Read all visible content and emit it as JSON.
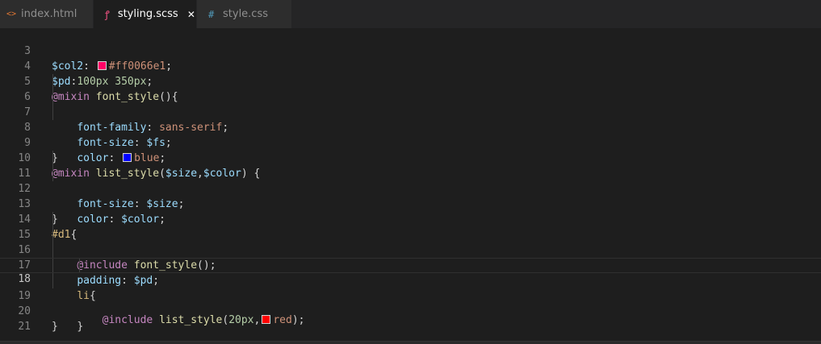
{
  "tabs": [
    {
      "label": "index.html",
      "icon": "html-icon",
      "glyph": "<>"
    },
    {
      "label": "styling.scss",
      "icon": "sass-icon",
      "glyph": "ꝭ",
      "active": true,
      "close": "✕"
    },
    {
      "label": "style.css",
      "icon": "css-icon",
      "glyph": "#"
    }
  ],
  "colors": {
    "col2_swatch": "#ff0066",
    "blue_swatch": "#0000ff",
    "red_swatch": "#ff0000"
  },
  "code": {
    "line_numbers": [
      "3",
      "4",
      "5",
      "6",
      "7",
      "8",
      "9",
      "10",
      "11",
      "12",
      "13",
      "14",
      "15",
      "16",
      "17",
      "18",
      "19",
      "20",
      "21"
    ],
    "l3": {
      "var": "$col2",
      "colon": ": ",
      "value": "#ff0066e1",
      "semi": ";"
    },
    "l4": {
      "var": "$pd",
      "colon": ":",
      "value": "100px 350px",
      "semi": ";"
    },
    "l5": {
      "kw": "@mixin",
      "name": "font_style",
      "rest": "(){"
    },
    "l6": {
      "prop": "font-family",
      "colon": ": ",
      "value": "sans-serif",
      "semi": ";"
    },
    "l7": {
      "prop": "font-size",
      "colon": ": ",
      "value": "$fs",
      "semi": ";"
    },
    "l8": {
      "prop": "color",
      "colon": ": ",
      "value": "blue",
      "semi": ";"
    },
    "l9": {
      "text": "}"
    },
    "l10": {
      "kw": "@mixin",
      "name": "list_style",
      "open": "(",
      "arg1": "$size",
      "comma": ",",
      "arg2": "$color",
      "close": ") {"
    },
    "l11": {
      "prop": "font-size",
      "colon": ": ",
      "value": "$size",
      "semi": ";"
    },
    "l12": {
      "prop": "color",
      "colon": ": ",
      "value": "$color",
      "semi": ";"
    },
    "l13": {
      "text": "}"
    },
    "l14": {
      "sel": "#d1",
      "rest": "{"
    },
    "l15": {
      "kw": "@include",
      "name": "font_style",
      "rest": "();"
    },
    "l16": {
      "prop": "padding",
      "colon": ": ",
      "value": "$pd",
      "semi": ";"
    },
    "l17": {
      "tag": "li",
      "rest": "{"
    },
    "l18": {
      "kw": "@include",
      "name": "list_style",
      "open": "(",
      "num": "20px",
      "comma": ",",
      "value": "red",
      "close": ");"
    },
    "l19": {
      "text": "}"
    },
    "l20": {
      "text": "}"
    },
    "l21": {
      "text": ""
    }
  }
}
